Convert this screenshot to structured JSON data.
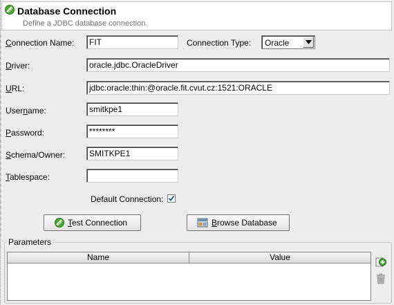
{
  "header": {
    "title": "Database Connection",
    "subtitle": "Define a JDBC database connection."
  },
  "form": {
    "connection_name": {
      "label_pre": "",
      "label_mnemonic": "C",
      "label_post": "onnection Name:",
      "value": "FIT"
    },
    "connection_type": {
      "label": "Connection Type:",
      "value": "Oracle"
    },
    "driver": {
      "label_pre": "",
      "label_mnemonic": "D",
      "label_post": "river:",
      "value": "oracle.jdbc.OracleDriver"
    },
    "url": {
      "label_pre": "",
      "label_mnemonic": "U",
      "label_post": "RL:",
      "value": "jdbc:oracle:thin:@oracle.fit.cvut.cz:1521:ORACLE"
    },
    "username": {
      "label_pre": "User",
      "label_mnemonic": "n",
      "label_post": "ame:",
      "value": "smitkpe1"
    },
    "password": {
      "label_pre": "",
      "label_mnemonic": "P",
      "label_post": "assword:",
      "value": "********"
    },
    "schema": {
      "label_pre": "",
      "label_mnemonic": "S",
      "label_post": "chema/Owner:",
      "value": "SMITKPE1"
    },
    "tablespace": {
      "label_pre": "",
      "label_mnemonic": "T",
      "label_post": "ablespace:",
      "value": ""
    },
    "default_connection": {
      "label": "Default Connection:",
      "checked": true
    }
  },
  "buttons": {
    "test_connection": {
      "mnemonic": "T",
      "rest": "est Connection"
    },
    "browse_database": {
      "mnemonic": "B",
      "rest": "rowse Database"
    }
  },
  "parameters": {
    "title": "Parameters",
    "columns": [
      "Name",
      "Value"
    ],
    "rows": []
  },
  "icons": {
    "header": "database-connection-icon",
    "test": "connection-plug-icon",
    "browse": "database-browse-icon",
    "add": "add-parameter-icon",
    "delete": "delete-parameter-icon"
  },
  "colors": {
    "background": "#eeeeee",
    "subtitle": "#6f6f6f",
    "icon_green": "#3c9a2a"
  }
}
